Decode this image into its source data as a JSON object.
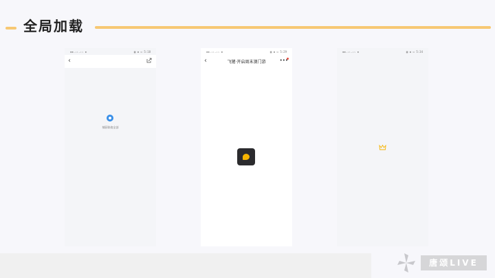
{
  "header": {
    "title": "全局加载"
  },
  "phones": [
    {
      "status_left": "▪▪.ᵢₗ.ᵢₗ ▪",
      "status_right": "▣ ✱ ▭ 5:18",
      "loading_text": "捕获联络全部"
    },
    {
      "status_left": "▪▪.ᵢₗ.ᵢₗ ▪",
      "status_right": "▣ ✱ ▭ 5:29",
      "nav_title": "飞猪·开启周末澳门游",
      "more": "•••"
    },
    {
      "status_left": "▪▪.ᵢₗ.ᵢₗ ▪",
      "status_right": "▣ ✱ ▭ 5:34"
    }
  ],
  "logo": {
    "text": "唐颂LIVE"
  },
  "colors": {
    "accent": "#f7c873",
    "spinner": "#3a8fe8",
    "app_yellow": "#f6b400"
  }
}
